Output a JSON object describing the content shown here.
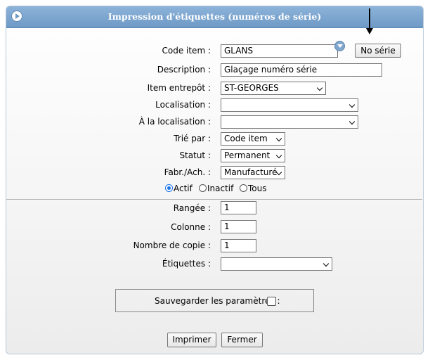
{
  "window": {
    "title": "Impression d'étiquettes (numéros de série)"
  },
  "form": {
    "code_item": {
      "label": "Code item :",
      "value": "GLANS",
      "button": "No série"
    },
    "description": {
      "label": "Description :",
      "value": "Glaçage numéro série"
    },
    "item_entrepot": {
      "label": "Item entrepôt :",
      "value": "ST-GEORGES"
    },
    "localisation": {
      "label": "Localisation :",
      "value": ""
    },
    "a_localisation": {
      "label": "À la localisation :",
      "value": ""
    },
    "trie_par": {
      "label": "Trié par :",
      "value": "Code item"
    },
    "statut": {
      "label": "Statut :",
      "value": "Permanent"
    },
    "fabr_ach": {
      "label": "Fabr./Ach. :",
      "value": "Manufacturé"
    },
    "status_filter": {
      "options": [
        "Actif",
        "Inactif",
        "Tous"
      ],
      "selected": "Actif"
    },
    "rangee": {
      "label": "Rangée :",
      "value": "1"
    },
    "colonne": {
      "label": "Colonne :",
      "value": "1"
    },
    "nombre_copie": {
      "label": "Nombre de copie :",
      "value": "1"
    },
    "etiquettes": {
      "label": "Étiquettes :",
      "value": ""
    },
    "save_params": {
      "label": "Sauvegarder les paramètres :",
      "checked": false
    }
  },
  "buttons": {
    "print": "Imprimer",
    "close": "Fermer"
  },
  "icons": {
    "title": "circle-arrow-icon",
    "lookup": "chevron-down-circle-icon",
    "annotation": "down-arrow-icon"
  },
  "colors": {
    "titlebar": "#7fa6cf",
    "radio_selected": "#1a73e8"
  }
}
